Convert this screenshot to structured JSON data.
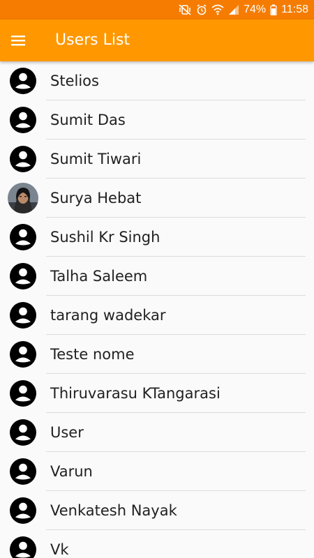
{
  "status_bar": {
    "battery_text": "74%",
    "time": "11:58",
    "icons": [
      "vibrate-mute-icon",
      "alarm-icon",
      "wifi-icon",
      "signal-icon",
      "battery-icon"
    ]
  },
  "app_bar": {
    "title": "Users List",
    "menu_icon": "hamburger-menu-icon",
    "color": "#ff9800",
    "status_color": "#f57c00"
  },
  "users": [
    {
      "name": "Stelios",
      "avatar": "default-person-icon"
    },
    {
      "name": "Sumit Das",
      "avatar": "default-person-icon"
    },
    {
      "name": "Sumit Tiwari",
      "avatar": "default-person-icon"
    },
    {
      "name": "Surya Hebat",
      "avatar": "profile-photo"
    },
    {
      "name": "Sushil Kr Singh",
      "avatar": "default-person-icon"
    },
    {
      "name": "Talha Saleem",
      "avatar": "default-person-icon"
    },
    {
      "name": "tarang wadekar",
      "avatar": "default-person-icon"
    },
    {
      "name": "Teste nome",
      "avatar": "default-person-icon"
    },
    {
      "name": "Thiruvarasu KTangarasi",
      "avatar": "default-person-icon"
    },
    {
      "name": "User",
      "avatar": "default-person-icon"
    },
    {
      "name": "Varun",
      "avatar": "default-person-icon"
    },
    {
      "name": "Venkatesh Nayak",
      "avatar": "default-person-icon"
    },
    {
      "name": "Vk",
      "avatar": "default-person-icon"
    }
  ]
}
